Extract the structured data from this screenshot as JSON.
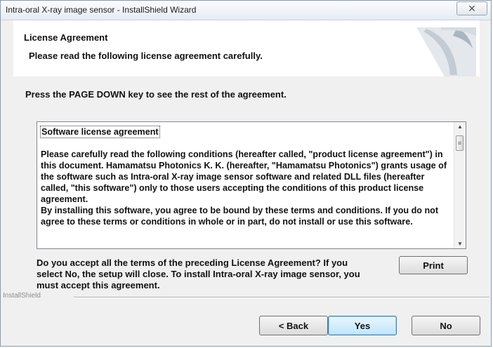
{
  "window": {
    "title": "Intra-oral X-ray image sensor - InstallShield Wizard",
    "close_symbol": "✕"
  },
  "header": {
    "title": "License Agreement",
    "subtitle": "Please read the following license agreement carefully."
  },
  "content": {
    "instruction": "Press the PAGE DOWN key to see the rest of the agreement.",
    "license": {
      "heading": "Software license agreement",
      "paragraphs": [
        "Please carefully read the following conditions (hereafter called, \"product license agreement\") in this document. Hamamatsu Photonics K. K. (hereafter, \"Hamamatsu Photonics\") grants usage of the software such as Intra-oral X-ray image sensor software and related DLL files (hereafter called, \"this software\") only to those users accepting the conditions of this product license agreement.",
        "By installing this software, you agree to be bound by these terms and conditions. If you do not agree to these terms or conditions in whole or in part, do not install or use this software."
      ]
    },
    "accept_question": "Do you accept all the terms of the preceding License Agreement? If you select No, the setup will close. To install Intra-oral X-ray image sensor, you must accept this agreement.",
    "print_label": "Print"
  },
  "footer": {
    "brand_label": "InstallShield",
    "back_label": "< Back",
    "yes_label": "Yes",
    "no_label": "No"
  }
}
